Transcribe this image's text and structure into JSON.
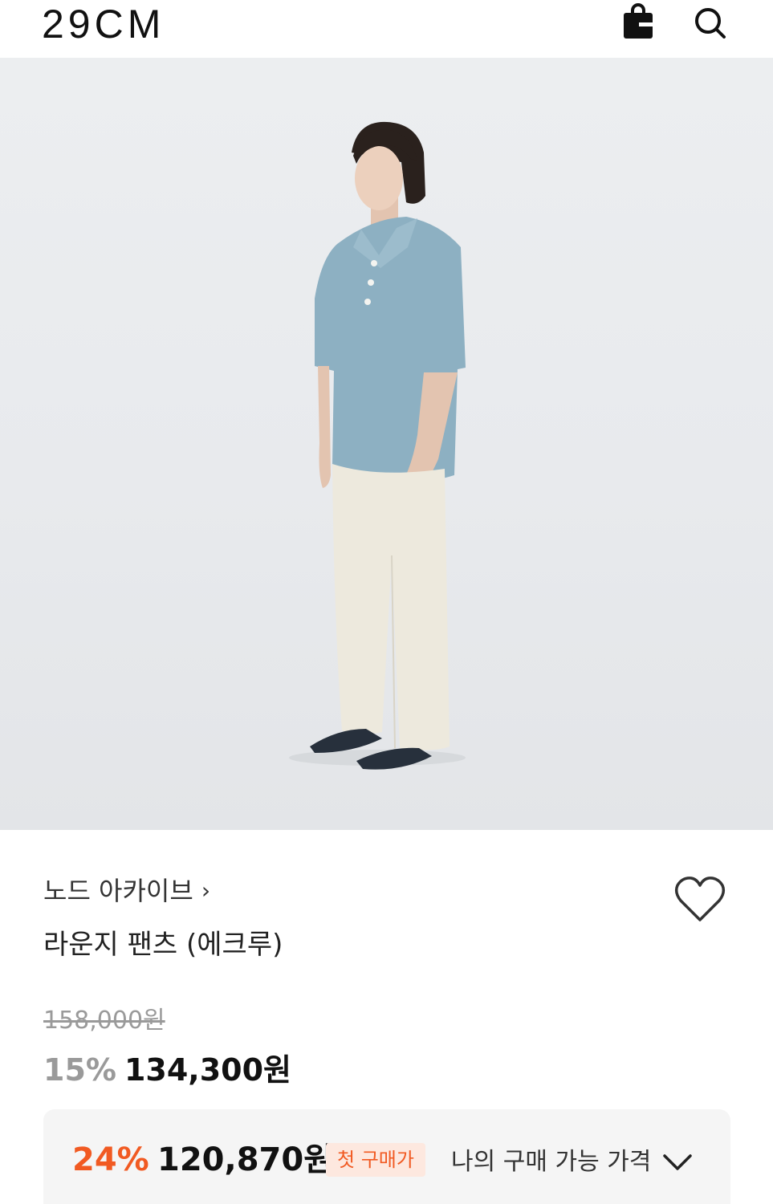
{
  "header": {
    "logo": "29CM",
    "bag_icon": "shopping-bag-icon",
    "search_icon": "search-icon"
  },
  "product": {
    "image_alt": "model wearing light blue terry polo shirt and ecru lounge pants",
    "brand": "노드 아카이브",
    "brand_chevron": "›",
    "name": "라운지 팬츠 (에크루)",
    "original_price": "158,000원",
    "discount_percent": "15%",
    "sale_price": "134,300원",
    "wishlist_icon": "heart-icon"
  },
  "personal_price": {
    "discount_percent": "24%",
    "price": "120,870원",
    "badge": "첫 구매가",
    "label": "나의 구매 가능 가격",
    "toggle_icon": "chevron-down-icon"
  },
  "colors": {
    "accent": "#f15a22",
    "badge_bg": "#fde8df",
    "shirt": "#8db0c2",
    "pants": "#ede9dd",
    "background": "#e9ebee"
  }
}
